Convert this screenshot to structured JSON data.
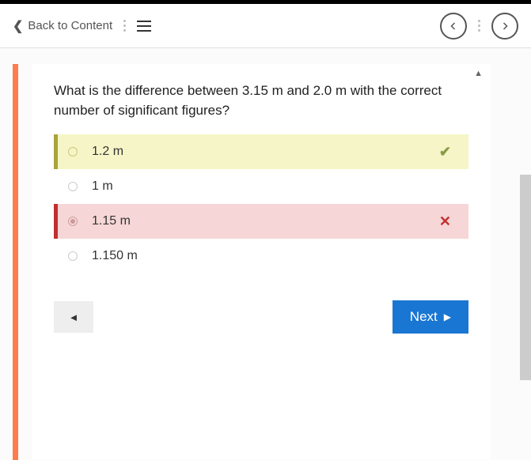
{
  "header": {
    "back_label": "Back to Content"
  },
  "question": "What is the difference between 3.15 m and 2.0 m with the correct number of significant figures?",
  "options": [
    {
      "label": "1.2 m",
      "state": "correct",
      "mark": "✔"
    },
    {
      "label": "1 m",
      "state": "plain",
      "mark": ""
    },
    {
      "label": "1.15 m",
      "state": "incorrect",
      "mark": "✕"
    },
    {
      "label": "1.150 m",
      "state": "plain",
      "mark": ""
    }
  ],
  "nav": {
    "next_label": "Next"
  }
}
